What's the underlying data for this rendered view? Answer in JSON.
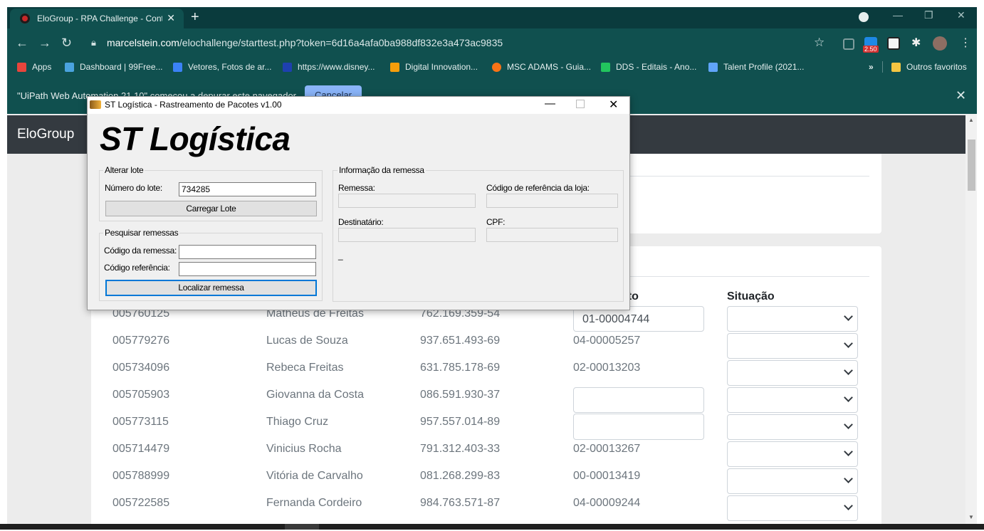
{
  "browser": {
    "tab_title": "EloGroup - RPA Challenge - Cont",
    "tab_close": "✕",
    "new_tab": "+",
    "url_host": "marcelstein.com",
    "url_path": "/elochallenge/starttest.php?token=6d16a4afa0ba988df832e3a473ac9835",
    "extension_badge": "2.50",
    "bookmarks": [
      {
        "label": "Apps",
        "color": "#e8453c"
      },
      {
        "label": "Dashboard | 99Free...",
        "color": "#4aa3df"
      },
      {
        "label": "Vetores, Fotos de ar...",
        "color": "#3b82f6"
      },
      {
        "label": "https://www.disney...",
        "color": "#1e40af"
      },
      {
        "label": "Digital Innovation...",
        "color": "#f59e0b"
      },
      {
        "label": "MSC ADAMS - Guia...",
        "color": "#f97316"
      },
      {
        "label": "DDS - Editais - Ano...",
        "color": "#22c55e"
      },
      {
        "label": "Talent Profile (2021...",
        "color": "#60a5fa"
      }
    ],
    "bookmarks_overflow": "»",
    "other_bookmarks": "Outros favoritos",
    "infobar_text": "\"UiPath Web Automation 21.10\" começou a depurar este navegador",
    "infobar_cancel": "Cancelar"
  },
  "page": {
    "brand": "EloGroup",
    "table": {
      "headers": {
        "document": "nto",
        "status": "Situação"
      },
      "rows": [
        {
          "code": "005760125",
          "name": "Matheus de Freitas",
          "cpf": "762.169.359-54",
          "doc": "01-00004744",
          "doc_input": true
        },
        {
          "code": "005779276",
          "name": "Lucas de Souza",
          "cpf": "937.651.493-69",
          "doc": "04-00005257",
          "doc_input": false
        },
        {
          "code": "005734096",
          "name": "Rebeca Freitas",
          "cpf": "631.785.178-69",
          "doc": "02-00013203",
          "doc_input": false
        },
        {
          "code": "005705903",
          "name": "Giovanna da Costa",
          "cpf": "086.591.930-37",
          "doc": "",
          "doc_input": true
        },
        {
          "code": "005773115",
          "name": "Thiago Cruz",
          "cpf": "957.557.014-89",
          "doc": "",
          "doc_input": true
        },
        {
          "code": "005714479",
          "name": "Vinicius Rocha",
          "cpf": "791.312.403-33",
          "doc": "02-00013267",
          "doc_input": false
        },
        {
          "code": "005788999",
          "name": "Vitória de Carvalho",
          "cpf": "081.268.299-83",
          "doc": "00-00013419",
          "doc_input": false
        },
        {
          "code": "005722585",
          "name": "Fernanda Cordeiro",
          "cpf": "984.763.571-87",
          "doc": "04-00009244",
          "doc_input": false
        }
      ]
    }
  },
  "dialog": {
    "title": "ST Logística - Rastreamento de Pacotes v1.00",
    "heading": "ST Logística",
    "alter_lote": {
      "legend": "Alterar lote",
      "lot_label": "Número do lote:",
      "lot_value": "734285",
      "load_button": "Carregar Lote"
    },
    "search": {
      "legend": "Pesquisar remessas",
      "code_label": "Código da remessa:",
      "code_value": "",
      "ref_label": "Código referência:",
      "ref_value": "",
      "search_button": "Localizar remessa"
    },
    "info": {
      "legend": "Informação da remessa",
      "shipment_label": "Remessa:",
      "store_ref_label": "Código de referência da loja:",
      "recipient_label": "Destinatário:",
      "cpf_label": "CPF:",
      "status_text": "_"
    }
  }
}
